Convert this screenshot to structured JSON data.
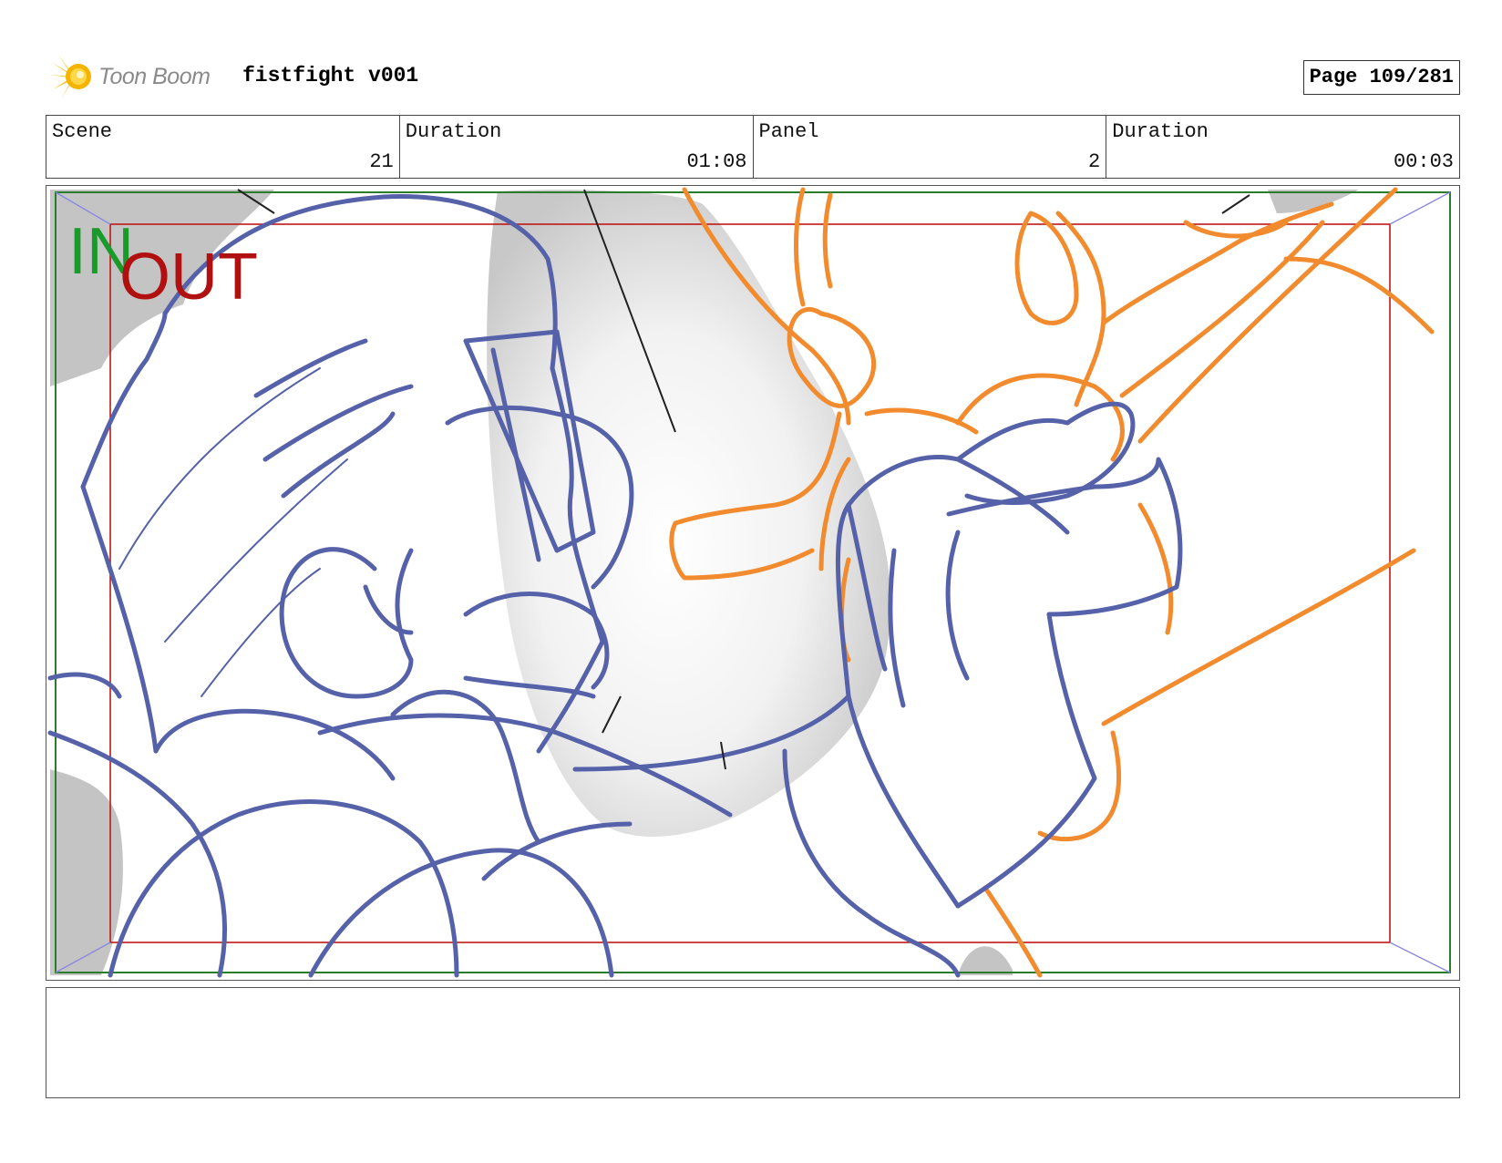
{
  "header": {
    "logo_text": "Toon Boom",
    "title": "fistfight v001",
    "page": "Page 109/281"
  },
  "info": {
    "scene_label": "Scene",
    "scene_value": "21",
    "scene_duration_label": "Duration",
    "scene_duration_value": "01:08",
    "panel_label": "Panel",
    "panel_value": "2",
    "panel_duration_label": "Duration",
    "panel_duration_value": "00:03"
  },
  "panel_overlay": {
    "in_label": "IN",
    "out_label": "OUT",
    "in_color": "#1a9a2a",
    "out_color": "#b01010",
    "figure_left_color": "#5561a8",
    "figure_right_color": "#f28a2e"
  },
  "notes": {
    "text": ""
  }
}
